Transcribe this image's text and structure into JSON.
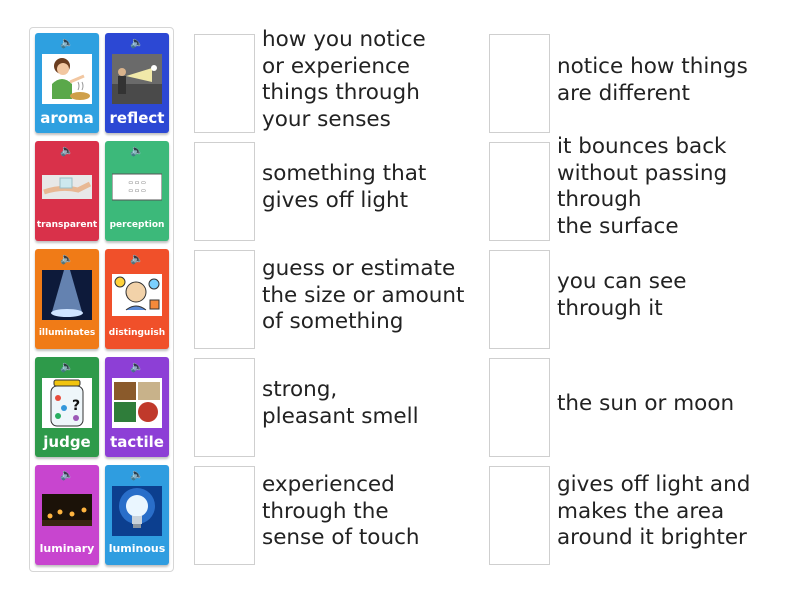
{
  "tiles": [
    {
      "word": "aroma",
      "color": "#2ea0e0",
      "icon": "speaker-icon",
      "image": "person-smelling-food"
    },
    {
      "word": "reflect",
      "color": "#2c48d4",
      "icon": "speaker-icon",
      "image": "people-with-light-beam"
    },
    {
      "word": "transparent",
      "color": "#d9314a",
      "icon": "speaker-icon",
      "image": "hand-with-glass"
    },
    {
      "word": "perception",
      "color": "#3cb97a",
      "icon": "speaker-icon",
      "image": "perception-diagram"
    },
    {
      "word": "illuminates",
      "color": "#f07b17",
      "icon": "speaker-icon",
      "image": "spotlight"
    },
    {
      "word": "distinguish",
      "color": "#f0502a",
      "icon": "speaker-icon",
      "image": "confused-person"
    },
    {
      "word": "judge",
      "color": "#2e9a4a",
      "icon": "speaker-icon",
      "image": "jar-of-candies"
    },
    {
      "word": "tactile",
      "color": "#8d3fd6",
      "icon": "speaker-icon",
      "image": "textures-collage"
    },
    {
      "word": "luminary",
      "color": "#c845cf",
      "icon": "speaker-icon",
      "image": "lanterns-at-night"
    },
    {
      "word": "luminous",
      "color": "#2f9de0",
      "icon": "speaker-icon",
      "image": "light-bulb"
    }
  ],
  "definitions_left": [
    "how you notice\nor experience\nthings through\nyour senses",
    "something that\ngives off light",
    "guess or estimate\nthe size or amount\nof something",
    "strong,\npleasant smell",
    "experienced\nthrough the\nsense of touch"
  ],
  "definitions_right": [
    "notice how things\nare different",
    "it bounces back\nwithout passing\nthrough\nthe surface",
    "you can see\nthrough it",
    "the sun or moon",
    "gives off light and\nmakes the area\naround it brighter"
  ]
}
